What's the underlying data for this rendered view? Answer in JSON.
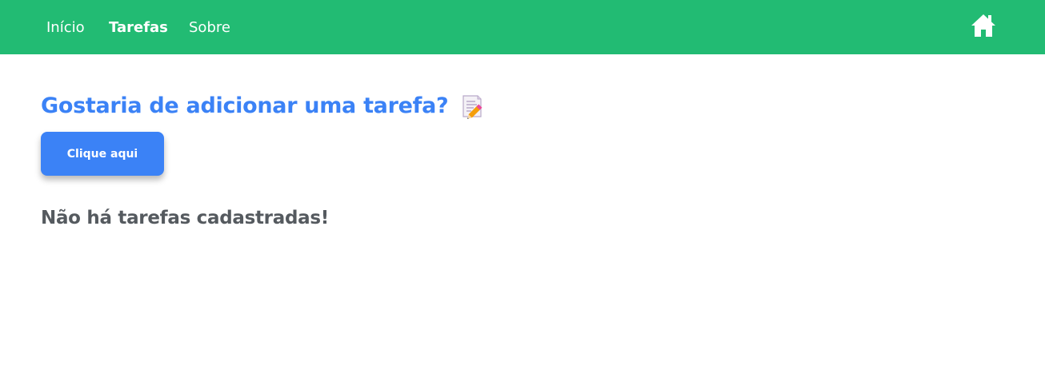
{
  "nav": {
    "links": [
      {
        "label": "Início",
        "active": false
      },
      {
        "label": "Tarefas",
        "active": true
      },
      {
        "label": "Sobre",
        "active": false
      }
    ],
    "home_icon": "home-icon",
    "background_color": "#22bb73"
  },
  "main": {
    "heading": "Gostaria de adicionar uma tarefa?",
    "heading_icon": "memo-icon",
    "heading_color": "#3b82f6",
    "button_label": "Clique aqui",
    "button_color": "#3b82f6",
    "empty_message": "Não há tarefas cadastradas!"
  }
}
